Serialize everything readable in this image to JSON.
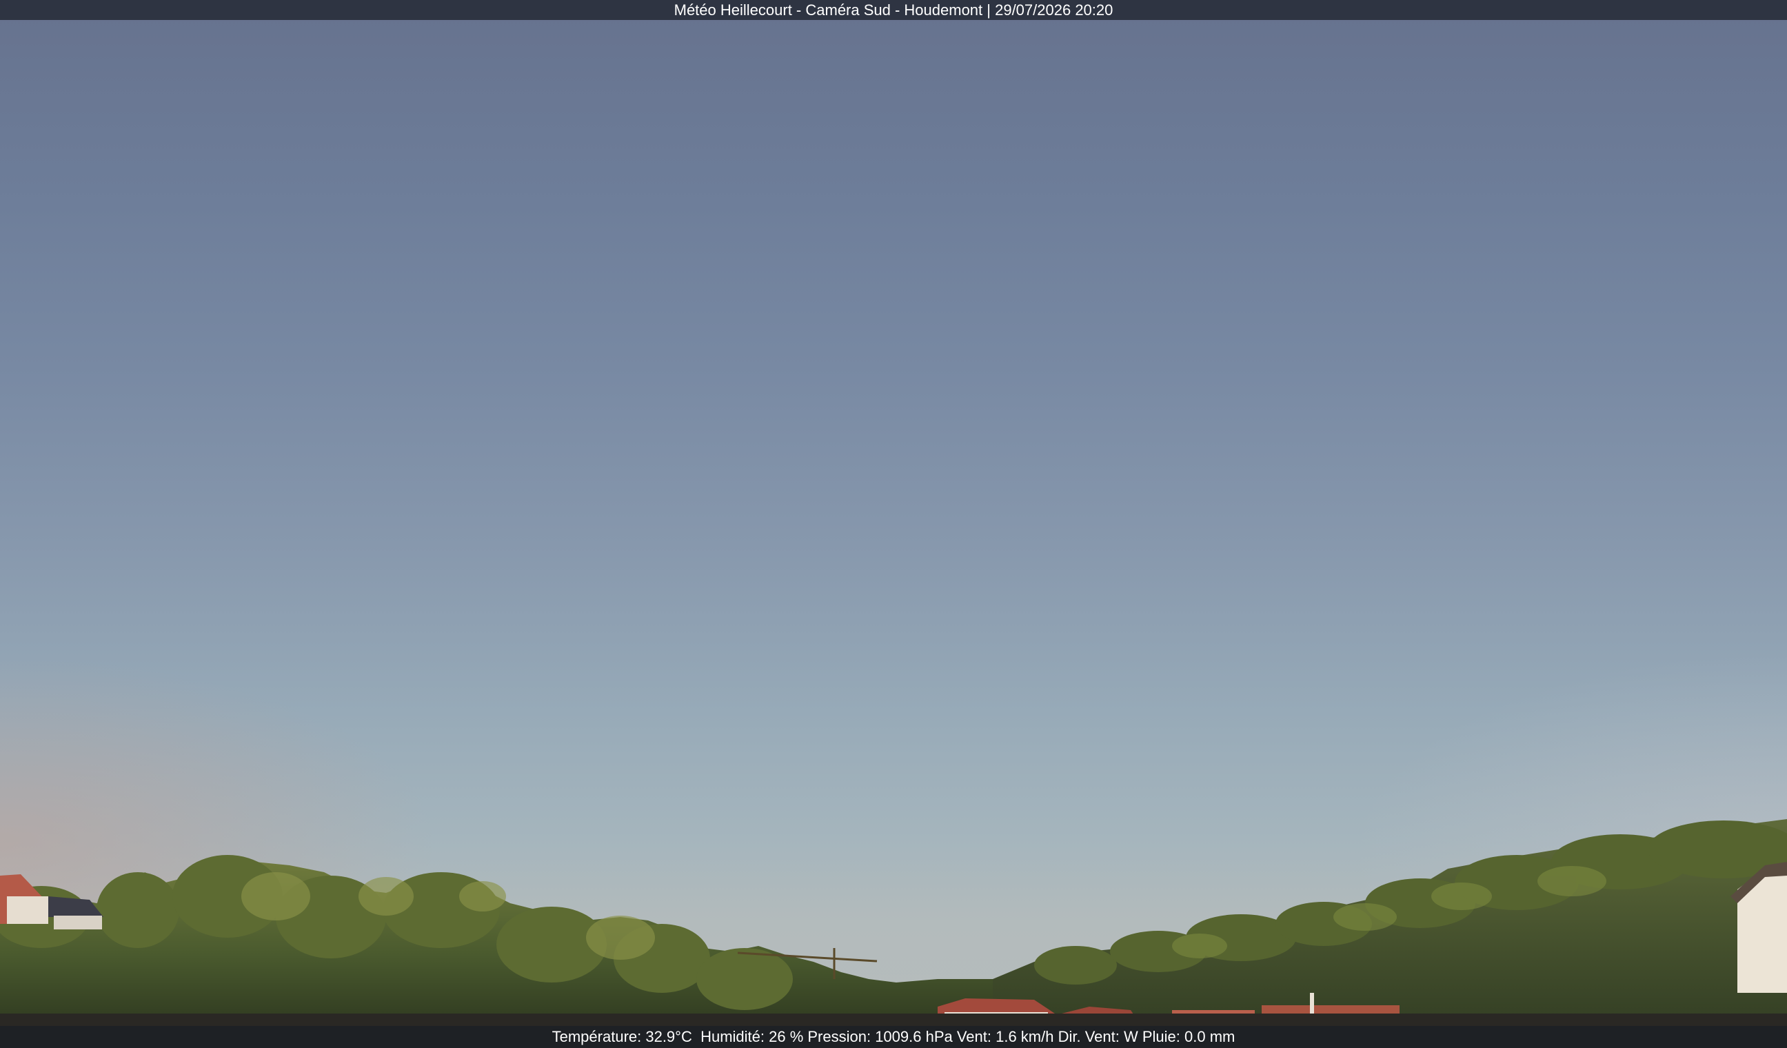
{
  "header": {
    "caption": "Météo Heillecourt - Caméra Sud - Houdemont | 29/07/2026 20:20"
  },
  "footer": {
    "weather_readout": "Température: 32.9°C  Humidité: 26 % Pression: 1009.6 hPa Vent: 1.6 km/h Dir. Vent: W Pluie: 0.0 mm"
  },
  "colors": {
    "bar_background": "#2e3442",
    "sky_top": "#66728e",
    "sky_horizon": "#b3bbbc",
    "foliage": "#3d4a2c"
  }
}
